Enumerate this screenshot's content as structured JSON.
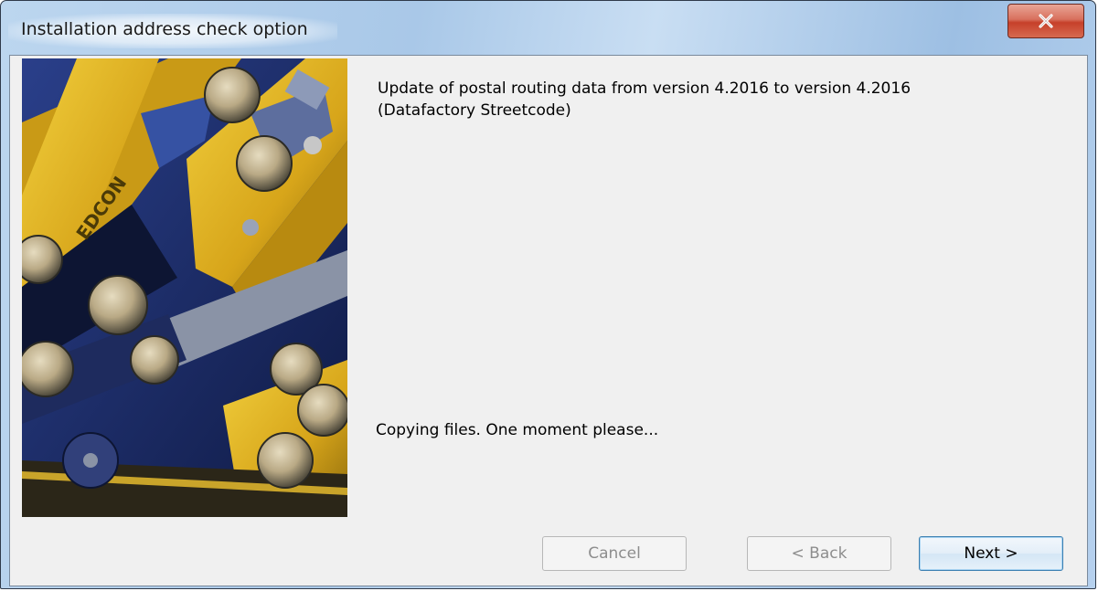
{
  "window": {
    "title": "Installation address check option",
    "close_glyph": "close-icon"
  },
  "banner": {
    "logo_text": "EDCON"
  },
  "content": {
    "heading_line1": "Update of postal routing data from version 4.2016 to version 4.2016",
    "heading_line2": "(Datafactory Streetcode)",
    "status": "Copying files. One moment please..."
  },
  "buttons": {
    "cancel": "Cancel",
    "back": "< Back",
    "next": "Next >"
  },
  "colors": {
    "titlebar": "#a9c8e8",
    "close_button": "#c6402a",
    "client_bg": "#f0f0f0",
    "default_button_border": "#3c7fb1"
  }
}
